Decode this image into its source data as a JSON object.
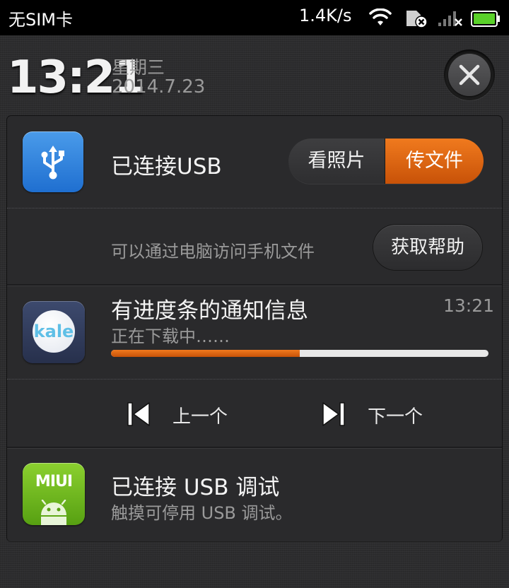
{
  "status_bar": {
    "carrier": "无SIM卡",
    "network_speed": "1.4K/s",
    "icons": [
      "wifi-icon",
      "sim-error-icon",
      "signal-icon",
      "battery-icon"
    ]
  },
  "header": {
    "time": "13:21",
    "weekday": "星期三",
    "date": "2014.7.23",
    "close_icon": "close-icon"
  },
  "notifications": {
    "usb": {
      "icon": "usb-icon",
      "title": "已连接USB",
      "options": [
        "看照片",
        "传文件"
      ],
      "selected_option": "传文件",
      "subtitle": "可以通过电脑访问手机文件",
      "help_label": "获取帮助"
    },
    "download": {
      "icon": "kale-app-icon",
      "icon_text": "kale",
      "title": "有进度条的通知信息",
      "time": "13:21",
      "status": "正在下载中……",
      "progress": 0.5
    },
    "player": {
      "prev_label": "上一个",
      "next_label": "下一个"
    },
    "usb_debug": {
      "icon": "miui-android-icon",
      "icon_text": "MIUI",
      "title": "已连接 USB 调试",
      "subtitle": "触摸可停用 USB 调试。"
    }
  },
  "colors": {
    "accent": "#e86a10",
    "background": "#2c2c2e",
    "panel": "#2a2a2c",
    "secondary_text": "#9a9a9a"
  }
}
